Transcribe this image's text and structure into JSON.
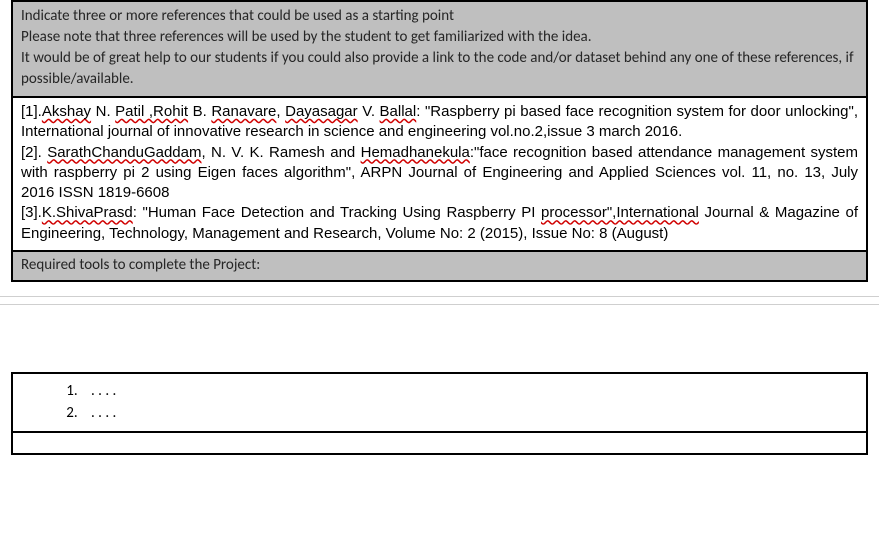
{
  "refs_header": {
    "line1": "Indicate three or more references that could be used as a starting point",
    "line2": "Please note that three references will be used by the student to get familiarized with the idea.",
    "line3": "It would be of great help to our students if you could also provide a link to the code and/or dataset behind any one of these references, if possible/available."
  },
  "references": [
    {
      "prefix": "[1].",
      "sq1": "Akshay",
      "t1": " N. ",
      "sq2": "Patil ,Rohit",
      "t2": " B. ",
      "sq3": "Ranavare",
      "t3": ", ",
      "sq4": "Dayasagar",
      "t4": " V. ",
      "sq5": "Ballal",
      "t5": ": \"Raspberry pi based face recognition system for door unlocking\", International journal of innovative research in science and engineering vol.no.2,issue 3 march 2016."
    },
    {
      "prefix": "[2]. ",
      "sq1": "SarathChanduGaddam",
      "t1": ", N. V. K. Ramesh and ",
      "sq2": "Hemadhanekula",
      "t2": ":\"face recognition based attendance management system with raspberry pi 2 using Eigen faces algorithm\", ARPN Journal of Engineering and Applied Sciences vol. 11, no. 13, July 2016 ISSN 1819-6608"
    },
    {
      "prefix": "[3].",
      "sq1": "K.ShivaPrasd",
      "t1": ": \"Human Face Detection and Tracking Using Raspberry PI ",
      "sq2": "processor\",International",
      "t2": " Journal & Magazine of Engineering, Technology, Management and Research, Volume No: 2 (2015), Issue No: 8 (August)"
    }
  ],
  "tools_header": "Required tools to complete the Project:",
  "tools_items": [
    ". . . .",
    ". . . ."
  ]
}
